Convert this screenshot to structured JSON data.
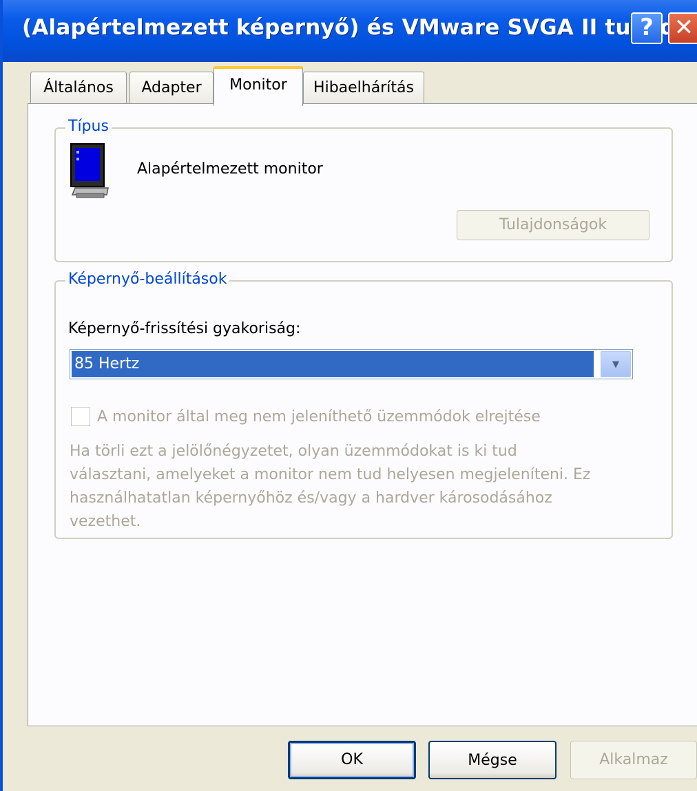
{
  "window": {
    "title": "(Alapértelmezett képernyő) és VMware SVGA II tulajd...",
    "help_glyph": "?",
    "close_glyph": "✕"
  },
  "tabs": [
    {
      "label": "Általános",
      "active": false
    },
    {
      "label": "Adapter",
      "active": false
    },
    {
      "label": "Monitor",
      "active": true
    },
    {
      "label": "Hibaelhárítás",
      "active": false
    }
  ],
  "type_group": {
    "label": "Típus",
    "monitor_name": "Alapértelmezett monitor",
    "properties_button": "Tulajdonságok"
  },
  "screen_settings": {
    "label": "Képernyő-beállítások",
    "refresh_label": "Képernyő-frissítési gyakoriság:",
    "refresh_value": "85 Hertz",
    "hide_modes_label": "A monitor által meg nem jeleníthető üzemmódok elrejtése",
    "hide_modes_checked": false,
    "warning_lines": [
      "Ha törli ezt a jelölőnégyzetet, olyan üzemmódokat is ki tud",
      "választani, amelyeket a monitor nem tud helyesen megjeleníteni. Ez",
      "használhatatlan képernyőhöz és/vagy a hardver károsodásához",
      "vezethet."
    ]
  },
  "footer": {
    "ok": "OK",
    "cancel": "Mégse",
    "apply": "Alkalmaz"
  },
  "colors": {
    "titlebar": "#0A5CE8",
    "group_label": "#0046D5",
    "selection": "#316AC5",
    "disabled_text": "#ACA899",
    "window_bg": "#ECE9D8"
  }
}
